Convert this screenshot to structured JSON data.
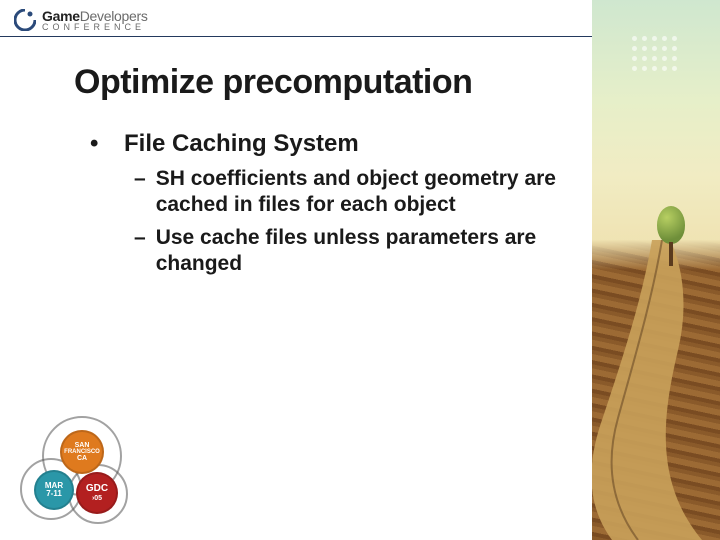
{
  "header": {
    "brand_game": "Game",
    "brand_dev": "Developers",
    "brand_conf": "Conference"
  },
  "slide": {
    "title": "Optimize precomputation",
    "bullet": "File Caching System",
    "subs": [
      "SH coefficients and object geometry are cached in files for each object",
      "Use cache files unless parameters are changed"
    ]
  },
  "badges": {
    "orange_l1": "SAN",
    "orange_l2": "FRANCISCO",
    "orange_l3": "CA",
    "teal_l1": "MAR",
    "teal_l2": "7-11",
    "red_l1": "GDC",
    "red_l2": "›05"
  }
}
